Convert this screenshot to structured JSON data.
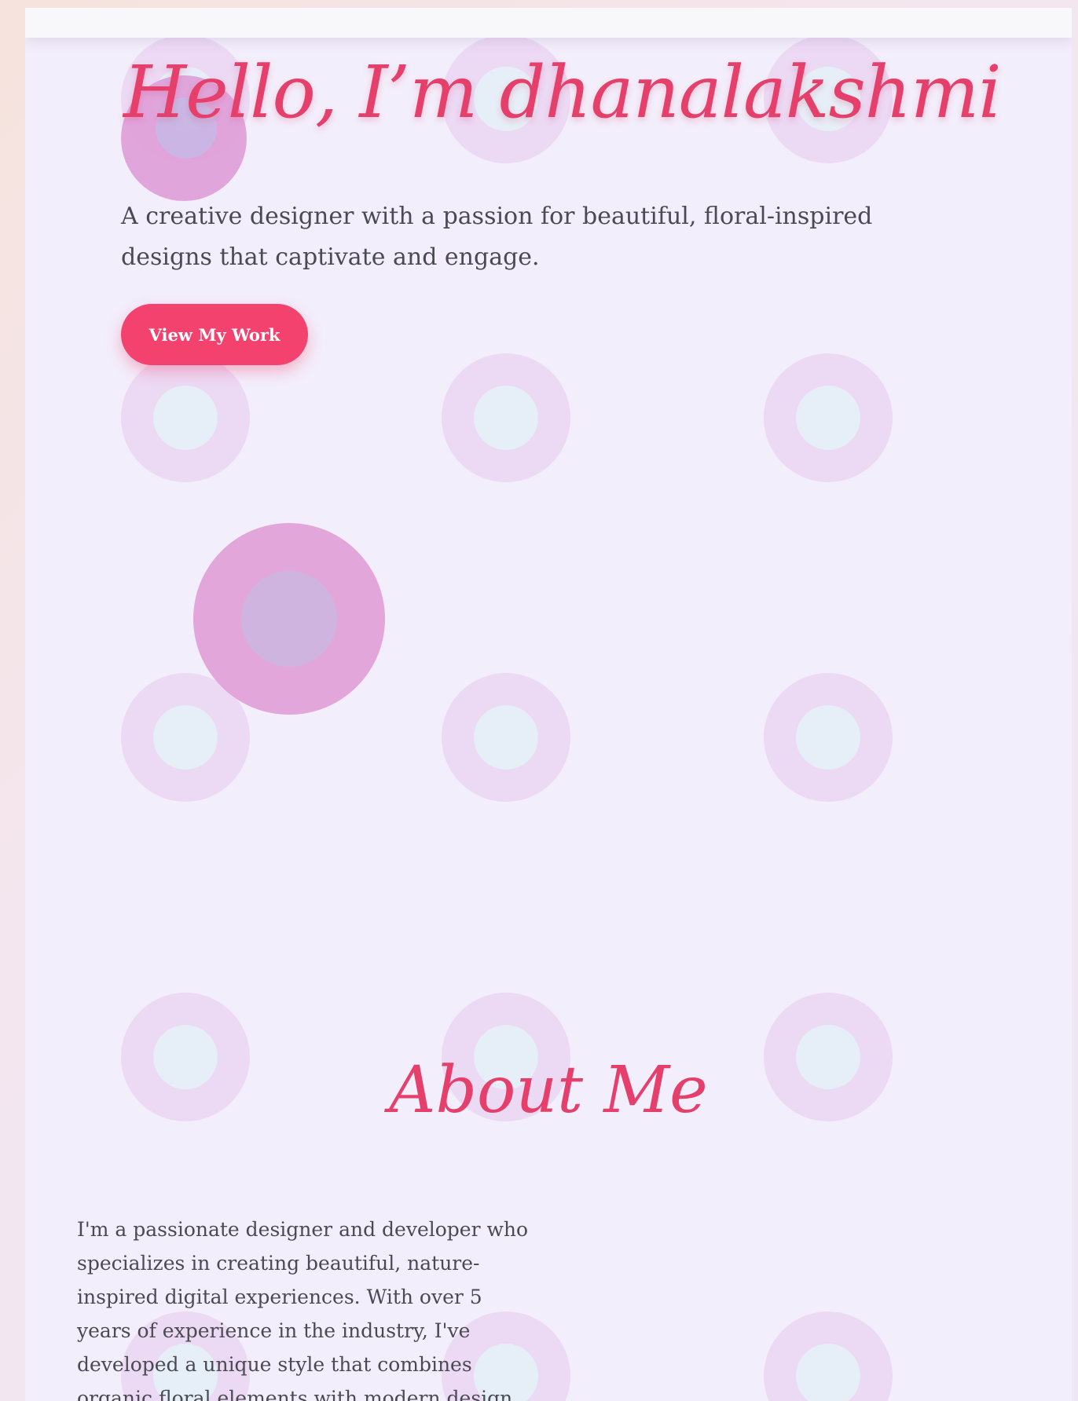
{
  "hero": {
    "title": "Hello, I’m dhanalakshmi",
    "subtitle": "A creative designer with a passion for beautiful, floral-inspired designs that captivate and engage.",
    "cta_label": "View My Work"
  },
  "about": {
    "title": "About Me",
    "text": "I'm a passionate designer and developer who specializes in creating beautiful, nature-inspired digital experiences. With over 5 years of experience in the industry, I've developed a unique style that combines organic floral elements with modern design principles."
  },
  "colors": {
    "accent": "#e5406b",
    "button": "#f2426d",
    "background": "#f3eefb",
    "text": "#4a4a52"
  }
}
